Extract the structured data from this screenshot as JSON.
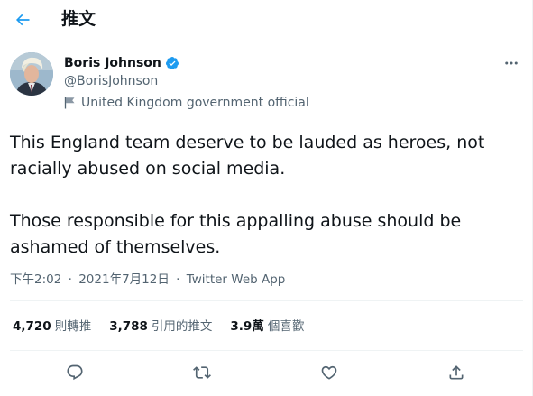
{
  "header": {
    "title": "推文"
  },
  "author": {
    "name": "Boris Johnson",
    "handle": "@BorisJohnson",
    "label": "United Kingdom government official"
  },
  "tweet": {
    "paragraphs": [
      "This England team deserve to be lauded as heroes, not racially abused on social media.",
      "Those responsible for this appalling abuse should be ashamed of themselves."
    ],
    "time": "下午2:02",
    "date": "2021年7月12日",
    "separator": "·",
    "source": "Twitter Web App"
  },
  "stats": {
    "retweets_count": "4,720",
    "retweets_label": "則轉推",
    "quotes_count": "3,788",
    "quotes_label": "引用的推文",
    "likes_count": "3.9萬",
    "likes_label": "個喜歡"
  },
  "colors": {
    "accent": "#1d9bf0",
    "text_primary": "#0f1419",
    "text_secondary": "#536471",
    "divider": "#eff3f4"
  },
  "icons": {
    "back": "arrow-left-icon",
    "verified": "verified-badge-icon",
    "government": "flag-icon",
    "more": "more-horizontal-icon",
    "reply": "reply-icon",
    "retweet": "retweet-icon",
    "like": "heart-icon",
    "share": "share-icon"
  }
}
